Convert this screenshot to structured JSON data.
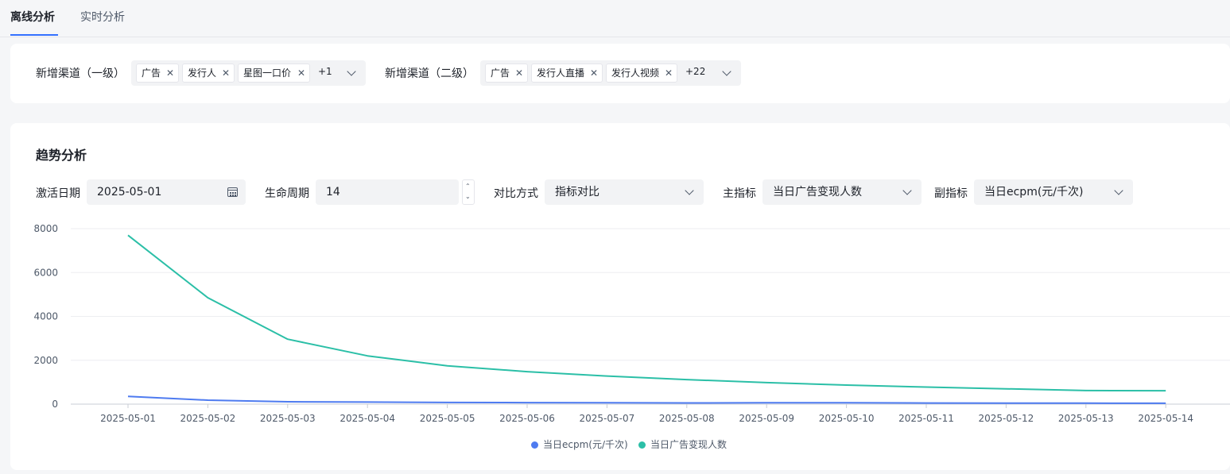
{
  "tabs": [
    {
      "label": "离线分析",
      "active": true
    },
    {
      "label": "实时分析",
      "active": false
    }
  ],
  "filters": {
    "channel_l1": {
      "label": "新增渠道（一级）",
      "chips": [
        "广告",
        "发行人",
        "星图一口价"
      ],
      "more": "+1"
    },
    "channel_l2": {
      "label": "新增渠道（二级）",
      "chips": [
        "广告",
        "发行人直播",
        "发行人视频"
      ],
      "more": "+22"
    }
  },
  "trend": {
    "title": "趋势分析",
    "activation_date": {
      "label": "激活日期",
      "value": "2025-05-01"
    },
    "lifecycle": {
      "label": "生命周期",
      "value": "14"
    },
    "compare_mode": {
      "label": "对比方式",
      "value": "指标对比"
    },
    "main_metric": {
      "label": "主指标",
      "value": "当日广告变现人数"
    },
    "sub_metric": {
      "label": "副指标",
      "value": "当日ecpm(元/千次)"
    }
  },
  "colors": {
    "accent": "#3370ff",
    "ecpm": "#4e7bf0",
    "users": "#2bbfa7"
  },
  "chart_data": {
    "type": "line",
    "x": [
      "2025-05-01",
      "2025-05-02",
      "2025-05-03",
      "2025-05-04",
      "2025-05-05",
      "2025-05-06",
      "2025-05-07",
      "2025-05-08",
      "2025-05-09",
      "2025-05-10",
      "2025-05-11",
      "2025-05-12",
      "2025-05-13",
      "2025-05-14"
    ],
    "series": [
      {
        "name": "当日ecpm(元/千次)",
        "color": "#4e7bf0",
        "values": [
          350,
          180,
          110,
          95,
          75,
          70,
          60,
          55,
          60,
          65,
          50,
          45,
          45,
          40
        ]
      },
      {
        "name": "当日广告变现人数",
        "color": "#2bbfa7",
        "values": [
          7700,
          4850,
          2960,
          2200,
          1750,
          1480,
          1280,
          1120,
          980,
          870,
          780,
          700,
          620,
          610
        ]
      }
    ],
    "yticks": [
      0,
      2000,
      4000,
      6000,
      8000
    ],
    "ylim": [
      0,
      8000
    ],
    "grid": true,
    "legend_position": "bottom"
  }
}
